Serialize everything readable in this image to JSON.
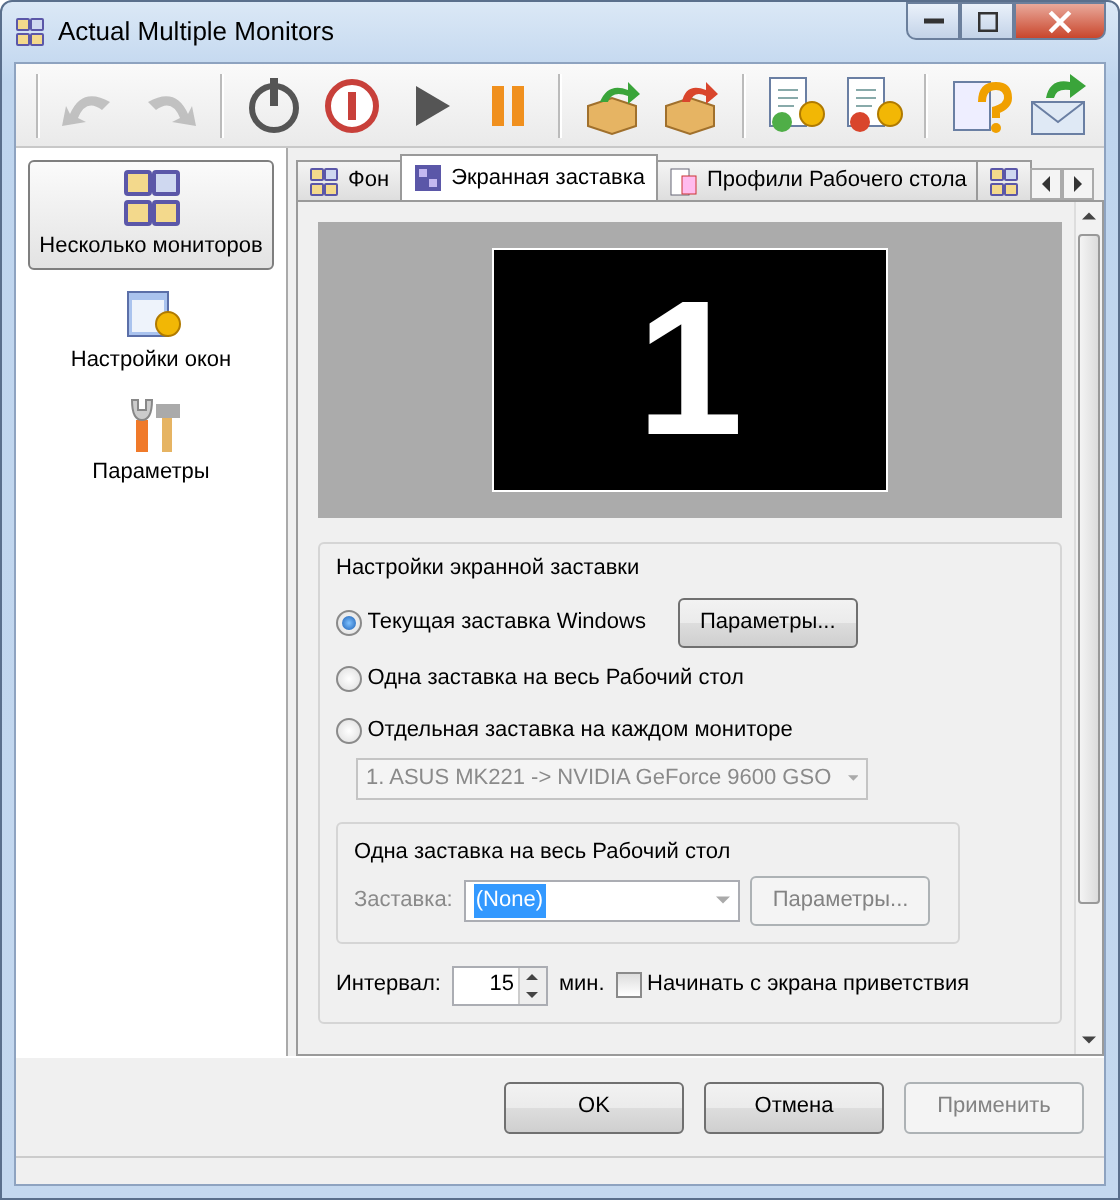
{
  "window": {
    "title": "Actual Multiple Monitors"
  },
  "toolbar": [
    {
      "kind": "undo",
      "disabled": true
    },
    {
      "kind": "redo",
      "disabled": true
    },
    {
      "kind": "power",
      "disabled": false
    },
    {
      "kind": "stop",
      "disabled": false
    },
    {
      "kind": "play",
      "disabled": false
    },
    {
      "kind": "pause",
      "disabled": false
    },
    {
      "kind": "box-in",
      "disabled": false
    },
    {
      "kind": "box-out",
      "disabled": false
    },
    {
      "kind": "doc-user-green",
      "disabled": false
    },
    {
      "kind": "doc-user-red",
      "disabled": false
    },
    {
      "kind": "help",
      "disabled": false
    },
    {
      "kind": "mail",
      "disabled": false
    }
  ],
  "sidebar": {
    "items": [
      {
        "label": "Несколько мониторов",
        "kind": "monitors",
        "selected": true
      },
      {
        "label": "Настройки окон",
        "kind": "windows",
        "selected": false
      },
      {
        "label": "Параметры",
        "kind": "tools",
        "selected": false
      }
    ]
  },
  "tabs": [
    {
      "label": "Фон",
      "selected": false
    },
    {
      "label": "Экранная заставка",
      "selected": true
    },
    {
      "label": "Профили Рабочего стола",
      "selected": false
    },
    {
      "selected": false
    }
  ],
  "preview": {
    "monitor_number": "1"
  },
  "screensaver_group": {
    "title": "Настройки экранной заставки",
    "options": [
      {
        "label": "Текущая заставка Windows",
        "selected": true,
        "button": "Параметры..."
      },
      {
        "label": "Одна заставка на весь Рабочий стол",
        "selected": false
      },
      {
        "label": "Отдельная заставка на каждом мониторе",
        "selected": false
      }
    ],
    "monitor_select": {
      "value": "1. ASUS MK221 -> NVIDIA GeForce 9600 GSO",
      "disabled": true
    }
  },
  "single_group": {
    "title": "Одна заставка на весь Рабочий стол",
    "label": "Заставка:",
    "select_value": "(None)",
    "button": "Параметры...",
    "disabled": true
  },
  "interval": {
    "label": "Интервал:",
    "value": "15",
    "unit": "мин.",
    "checkbox": {
      "label": "Начинать с экрана приветствия",
      "checked": false
    }
  },
  "buttons": [
    {
      "label": "OK",
      "disabled": false
    },
    {
      "label": "Отмена",
      "disabled": false
    },
    {
      "label": "Применить",
      "disabled": true
    }
  ]
}
